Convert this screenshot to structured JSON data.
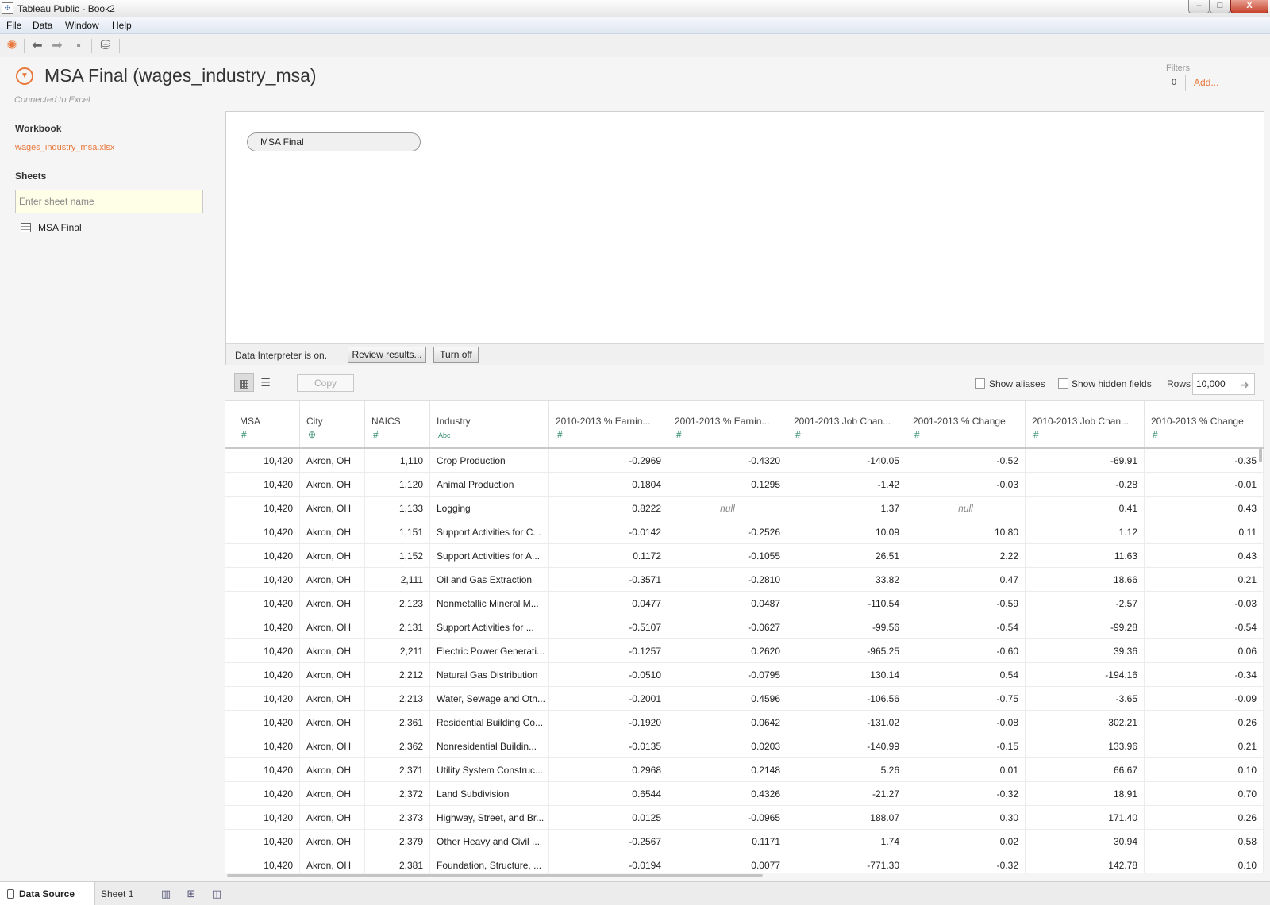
{
  "window": {
    "title": "Tableau Public - Book2",
    "minimize": "–",
    "maximize": "□",
    "close": "X"
  },
  "menu": [
    "File",
    "Data",
    "Window",
    "Help"
  ],
  "toolbar_icons": [
    "tableau-logo-icon",
    "back-arrow-icon",
    "forward-arrow-icon",
    "save-icon",
    "new-data-source-icon"
  ],
  "datasource": {
    "title": "MSA Final (wages_industry_msa)",
    "connection": "Connected to Excel"
  },
  "filters": {
    "label": "Filters",
    "count": "0",
    "add": "Add..."
  },
  "sidebar": {
    "workbook_heading": "Workbook",
    "workbook_file": "wages_industry_msa.xlsx",
    "sheets_heading": "Sheets",
    "search_placeholder": "Enter sheet name",
    "sheets": [
      "MSA Final"
    ]
  },
  "canvas": {
    "table_pill": "MSA Final",
    "interpreter_text": "Data Interpreter is on.",
    "review_button": "Review results...",
    "turn_off_button": "Turn off"
  },
  "grid_toolbar": {
    "copy": "Copy",
    "show_aliases": "Show aliases",
    "show_hidden": "Show hidden fields",
    "rows_label": "Rows",
    "rows_value": "10,000"
  },
  "columns": [
    {
      "name": "MSA",
      "type": "#",
      "align": "num"
    },
    {
      "name": "City",
      "type": "⊕",
      "align": "txt"
    },
    {
      "name": "NAICS",
      "type": "#",
      "align": "num"
    },
    {
      "name": "Industry",
      "type": "Abc",
      "align": "txt"
    },
    {
      "name": "2010-2013 % Earnin...",
      "type": "#",
      "align": "num"
    },
    {
      "name": "2001-2013 % Earnin...",
      "type": "#",
      "align": "num"
    },
    {
      "name": "2001-2013 Job Chan...",
      "type": "#",
      "align": "num"
    },
    {
      "name": "2001-2013 % Change",
      "type": "#",
      "align": "num"
    },
    {
      "name": "2010-2013 Job Chan...",
      "type": "#",
      "align": "num"
    },
    {
      "name": "2010-2013 % Change",
      "type": "#",
      "align": "num"
    }
  ],
  "rows": [
    [
      "10,420",
      "Akron, OH",
      "1,110",
      "Crop Production",
      "-0.2969",
      "-0.4320",
      "-140.05",
      "-0.52",
      "-69.91",
      "-0.35"
    ],
    [
      "10,420",
      "Akron, OH",
      "1,120",
      "Animal Production",
      "0.1804",
      "0.1295",
      "-1.42",
      "-0.03",
      "-0.28",
      "-0.01"
    ],
    [
      "10,420",
      "Akron, OH",
      "1,133",
      "Logging",
      "0.8222",
      "null",
      "1.37",
      "null",
      "0.41",
      "0.43"
    ],
    [
      "10,420",
      "Akron, OH",
      "1,151",
      "Support Activities for C...",
      "-0.0142",
      "-0.2526",
      "10.09",
      "10.80",
      "1.12",
      "0.11"
    ],
    [
      "10,420",
      "Akron, OH",
      "1,152",
      "Support Activities for A...",
      "0.1172",
      "-0.1055",
      "26.51",
      "2.22",
      "11.63",
      "0.43"
    ],
    [
      "10,420",
      "Akron, OH",
      "2,111",
      "Oil and Gas Extraction",
      "-0.3571",
      "-0.2810",
      "33.82",
      "0.47",
      "18.66",
      "0.21"
    ],
    [
      "10,420",
      "Akron, OH",
      "2,123",
      "Nonmetallic Mineral M...",
      "0.0477",
      "0.0487",
      "-110.54",
      "-0.59",
      "-2.57",
      "-0.03"
    ],
    [
      "10,420",
      "Akron, OH",
      "2,131",
      "Support Activities for ...",
      "-0.5107",
      "-0.0627",
      "-99.56",
      "-0.54",
      "-99.28",
      "-0.54"
    ],
    [
      "10,420",
      "Akron, OH",
      "2,211",
      "Electric Power Generati...",
      "-0.1257",
      "0.2620",
      "-965.25",
      "-0.60",
      "39.36",
      "0.06"
    ],
    [
      "10,420",
      "Akron, OH",
      "2,212",
      "Natural Gas Distribution",
      "-0.0510",
      "-0.0795",
      "130.14",
      "0.54",
      "-194.16",
      "-0.34"
    ],
    [
      "10,420",
      "Akron, OH",
      "2,213",
      "Water, Sewage and Oth...",
      "-0.2001",
      "0.4596",
      "-106.56",
      "-0.75",
      "-3.65",
      "-0.09"
    ],
    [
      "10,420",
      "Akron, OH",
      "2,361",
      "Residential Building Co...",
      "-0.1920",
      "0.0642",
      "-131.02",
      "-0.08",
      "302.21",
      "0.26"
    ],
    [
      "10,420",
      "Akron, OH",
      "2,362",
      "Nonresidential Buildin...",
      "-0.0135",
      "0.0203",
      "-140.99",
      "-0.15",
      "133.96",
      "0.21"
    ],
    [
      "10,420",
      "Akron, OH",
      "2,371",
      "Utility System Construc...",
      "0.2968",
      "0.2148",
      "5.26",
      "0.01",
      "66.67",
      "0.10"
    ],
    [
      "10,420",
      "Akron, OH",
      "2,372",
      "Land Subdivision",
      "0.6544",
      "0.4326",
      "-21.27",
      "-0.32",
      "18.91",
      "0.70"
    ],
    [
      "10,420",
      "Akron, OH",
      "2,373",
      "Highway, Street, and Br...",
      "0.0125",
      "-0.0965",
      "188.07",
      "0.30",
      "171.40",
      "0.26"
    ],
    [
      "10,420",
      "Akron, OH",
      "2,379",
      "Other Heavy and Civil ...",
      "-0.2567",
      "0.1171",
      "1.74",
      "0.02",
      "30.94",
      "0.58"
    ],
    [
      "10,420",
      "Akron, OH",
      "2,381",
      "Foundation, Structure, ...",
      "-0.0194",
      "0.0077",
      "-771.30",
      "-0.32",
      "142.78",
      "0.10"
    ]
  ],
  "tabs": {
    "data_source": "Data Source",
    "sheet1": "Sheet 1"
  },
  "tab_icons": [
    "new-worksheet-icon",
    "new-dashboard-icon",
    "new-story-icon"
  ]
}
